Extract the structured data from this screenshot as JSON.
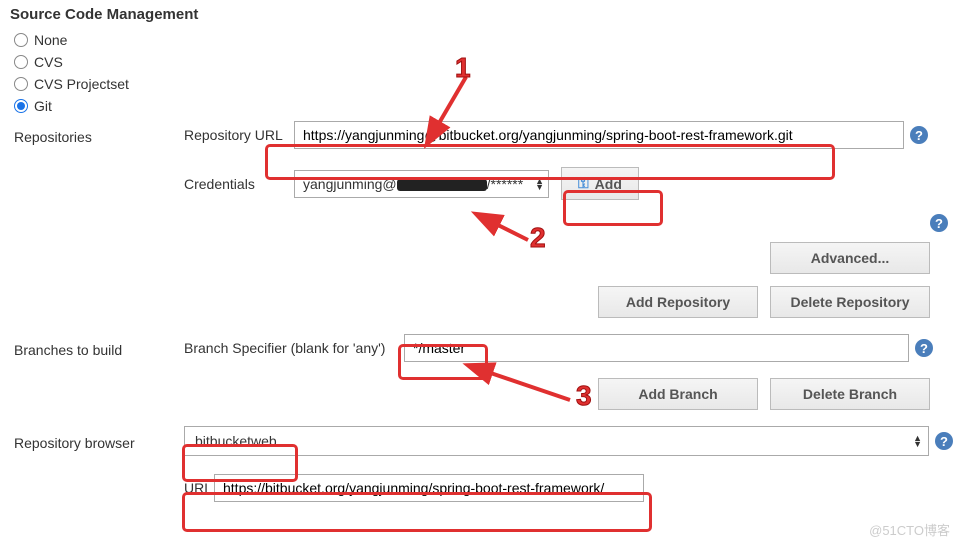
{
  "section_title": "Source Code Management",
  "scm": {
    "options": {
      "none": "None",
      "cvs": "CVS",
      "cvs_projectset": "CVS Projectset",
      "git": "Git"
    },
    "selected": "git"
  },
  "repositories": {
    "label": "Repositories",
    "repo_url_label": "Repository URL",
    "repo_url_value": "https://yangjunming@bitbucket.org/yangjunming/spring-boot-rest-framework.git",
    "credentials_label": "Credentials",
    "credentials_value": "yangjunming@",
    "credentials_masked_suffix": "/******",
    "add_button": "Add",
    "advanced_button": "Advanced...",
    "add_repo_button": "Add Repository",
    "delete_repo_button": "Delete Repository"
  },
  "branches": {
    "label": "Branches to build",
    "specifier_label": "Branch Specifier (blank for 'any')",
    "specifier_value": "*/master",
    "add_branch_button": "Add Branch",
    "delete_branch_button": "Delete Branch"
  },
  "browser": {
    "label": "Repository browser",
    "selected": "bitbucketweb",
    "url_label": "URL",
    "url_value": "https://bitbucket.org/yangjunming/spring-boot-rest-framework/"
  },
  "help_icon": "?",
  "annotations": {
    "n1": "1",
    "n2": "2",
    "n3": "3"
  },
  "watermark": "@51CTO博客"
}
